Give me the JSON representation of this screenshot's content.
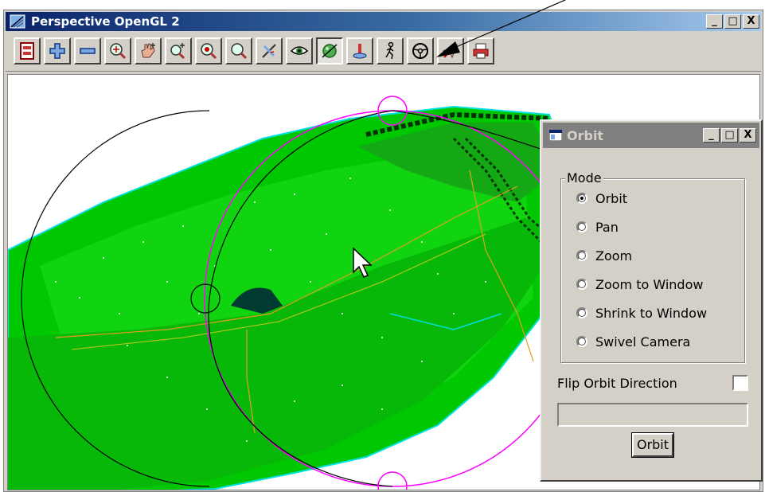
{
  "window": {
    "title": "Perspective OpenGL 2",
    "title_icon": "opengl-view-icon",
    "minimize_label": "_",
    "maximize_label": "□",
    "close_label": "X"
  },
  "toolbar": {
    "tools": [
      {
        "name": "plot-view-icon"
      },
      {
        "name": "add-icon"
      },
      {
        "name": "remove-icon"
      },
      {
        "name": "zoom-extent-icon"
      },
      {
        "name": "pan-hand-icon"
      },
      {
        "name": "zoom-in-icon"
      },
      {
        "name": "zoom-center-icon"
      },
      {
        "name": "zoom-icon"
      },
      {
        "name": "measure-icon"
      },
      {
        "name": "eye-view-icon"
      },
      {
        "name": "orbit-sphere-icon",
        "pressed": true
      },
      {
        "name": "joystick-icon"
      },
      {
        "name": "walk-icon"
      },
      {
        "name": "steering-wheel-icon"
      },
      {
        "name": "fly-icon"
      },
      {
        "name": "print-icon"
      }
    ]
  },
  "orbit_dialog": {
    "title": "Orbit",
    "title_icon": "orbit-window-icon",
    "minimize_label": "_",
    "maximize_label": "□",
    "close_label": "X",
    "mode_group_label": "Mode",
    "modes": [
      {
        "label": "Orbit",
        "checked": true
      },
      {
        "label": "Pan",
        "checked": false
      },
      {
        "label": "Zoom",
        "checked": false
      },
      {
        "label": "Zoom to Window",
        "checked": false
      },
      {
        "label": "Shrink to Window",
        "checked": false
      },
      {
        "label": "Swivel Camera",
        "checked": false
      }
    ],
    "flip_label": "Flip Orbit Direction",
    "flip_checked": false,
    "status_text": "",
    "orbit_button_label": "Orbit"
  },
  "colors": {
    "terrain": "#00cc00",
    "orbit_circle": "#ff00ff",
    "title_bar": "#0a246a"
  }
}
